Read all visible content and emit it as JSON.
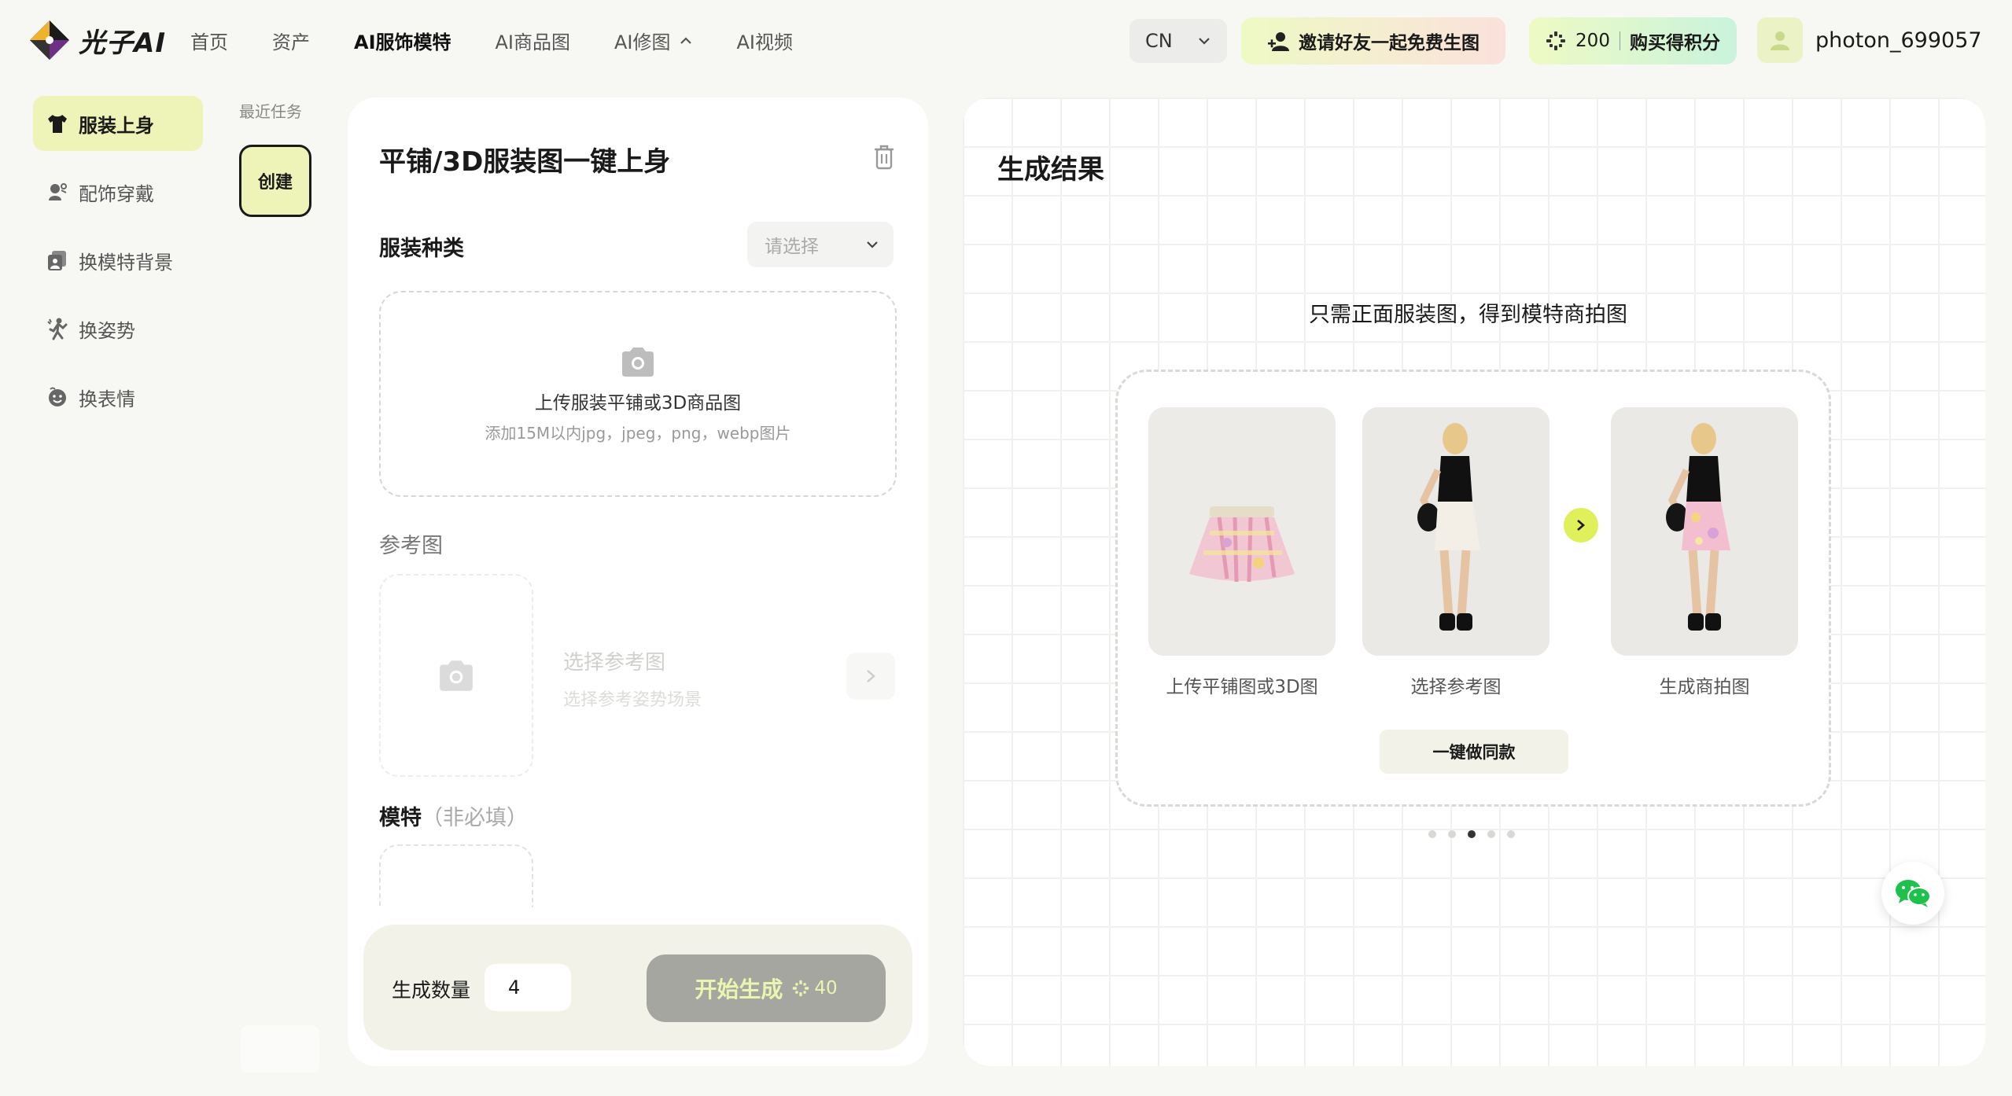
{
  "header": {
    "logo_text": "光子AI",
    "nav": [
      {
        "label": "首页",
        "active": false
      },
      {
        "label": "资产",
        "active": false
      },
      {
        "label": "AI服饰模特",
        "active": true
      },
      {
        "label": "AI商品图",
        "active": false
      },
      {
        "label": "AI修图",
        "active": false,
        "has_dropdown": true
      },
      {
        "label": "AI视频",
        "active": false
      }
    ],
    "language": "CN",
    "invite_label": "邀请好友一起免费生图",
    "points_value": "200",
    "buy_points_label": "购买得积分",
    "username": "photon_699057"
  },
  "sidebar": {
    "items": [
      {
        "label": "服装上身",
        "icon": "shirt-icon",
        "active": true
      },
      {
        "label": "配饰穿戴",
        "icon": "accessory-icon",
        "active": false
      },
      {
        "label": "换模特背景",
        "icon": "background-swap-icon",
        "active": false
      },
      {
        "label": "换姿势",
        "icon": "pose-icon",
        "active": false
      },
      {
        "label": "换表情",
        "icon": "expression-icon",
        "active": false
      }
    ],
    "recent_tasks_label": "最近任务",
    "create_label": "创建"
  },
  "form": {
    "title": "平铺/3D服装图一键上身",
    "category_label": "服装种类",
    "category_placeholder": "请选择",
    "upload_title": "上传服装平铺或3D商品图",
    "upload_hint": "添加15M以内jpg，jpeg，png，webp图片",
    "reference_label": "参考图",
    "reference_title": "选择参考图",
    "reference_hint": "选择参考姿势场景",
    "model_label": "模特",
    "model_optional": "（非必填）",
    "count_label": "生成数量",
    "count_value": "4",
    "generate_label": "开始生成",
    "generate_cost": "40"
  },
  "result": {
    "title": "生成结果",
    "hint": "只需正面服装图，得到模特商拍图",
    "steps": [
      {
        "caption": "上传平铺图或3D图"
      },
      {
        "caption": "选择参考图"
      },
      {
        "caption": "生成商拍图"
      }
    ],
    "same_style_label": "一键做同款",
    "carousel_count": 5,
    "carousel_active": 3
  },
  "colors": {
    "accent_lime": "#eef3b8",
    "next_button": "#dff05a",
    "generate_disabled": "#a6a6a0"
  }
}
